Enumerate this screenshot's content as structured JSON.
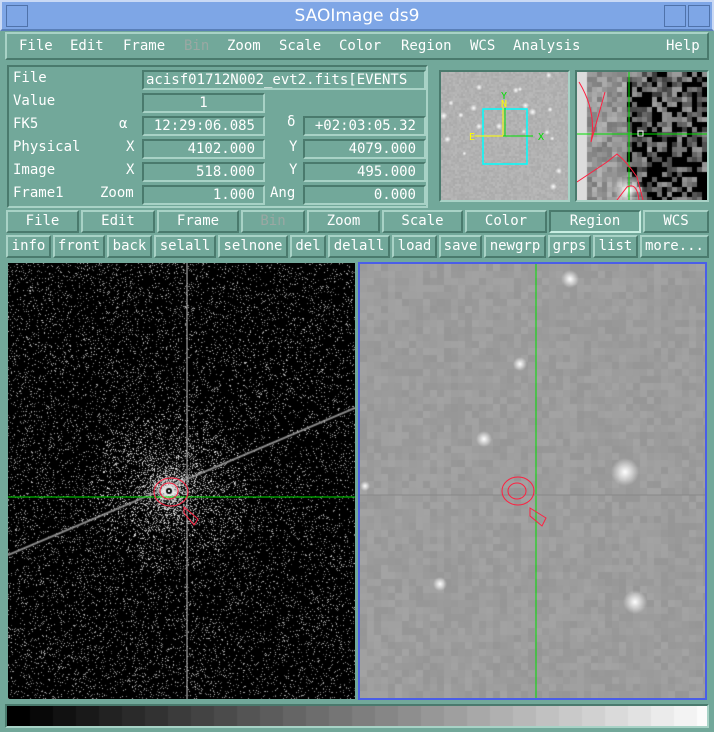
{
  "window": {
    "title": "SAOImage ds9"
  },
  "menubar": [
    {
      "label": "File"
    },
    {
      "label": "Edit"
    },
    {
      "label": "Frame"
    },
    {
      "label": "Bin",
      "disabled": true
    },
    {
      "label": "Zoom"
    },
    {
      "label": "Scale"
    },
    {
      "label": "Color"
    },
    {
      "label": "Region"
    },
    {
      "label": "WCS"
    },
    {
      "label": "Analysis"
    },
    {
      "label": "Help"
    }
  ],
  "info": {
    "file_label": "File",
    "file_value": "acisf01712N002_evt2.fits[EVENTS",
    "value_label": "Value",
    "value": "1",
    "fk5_label": "FK5",
    "alpha_label": "α",
    "alpha": "12:29:06.085",
    "delta_label": "δ",
    "delta": "+02:03:05.32",
    "physical_label": "Physical",
    "phys_x_label": "X",
    "phys_x": "4102.000",
    "phys_y_label": "Y",
    "phys_y": "4079.000",
    "image_label": "Image",
    "img_x_label": "X",
    "img_x": "518.000",
    "img_y_label": "Y",
    "img_y": "495.000",
    "frame_label": "Frame1",
    "zoom_label": "Zoom",
    "zoom": "1.000",
    "ang_label": "Ang",
    "ang": "0.000"
  },
  "panner": {
    "compass": {
      "north": "N",
      "east": "E",
      "x": "X",
      "y": "Y"
    }
  },
  "buttonbar": [
    {
      "label": "File"
    },
    {
      "label": "Edit"
    },
    {
      "label": "Frame"
    },
    {
      "label": "Bin",
      "disabled": true
    },
    {
      "label": "Zoom"
    },
    {
      "label": "Scale"
    },
    {
      "label": "Color"
    },
    {
      "label": "Region",
      "selected": true
    },
    {
      "label": "WCS"
    }
  ],
  "region_buttons": [
    {
      "label": "info"
    },
    {
      "label": "front"
    },
    {
      "label": "back"
    },
    {
      "label": "selall"
    },
    {
      "label": "selnone"
    },
    {
      "label": "del"
    },
    {
      "label": "delall"
    },
    {
      "label": "load"
    },
    {
      "label": "save"
    },
    {
      "label": "newgrp"
    },
    {
      "label": "grps"
    },
    {
      "label": "list"
    },
    {
      "label": "more..."
    }
  ],
  "colors": {
    "crosshair": "#00e000",
    "contour": "#ff2040",
    "panner_box": "#00ffff",
    "compass": "#ffff00",
    "current_frame_border": "#4a5ee8"
  }
}
